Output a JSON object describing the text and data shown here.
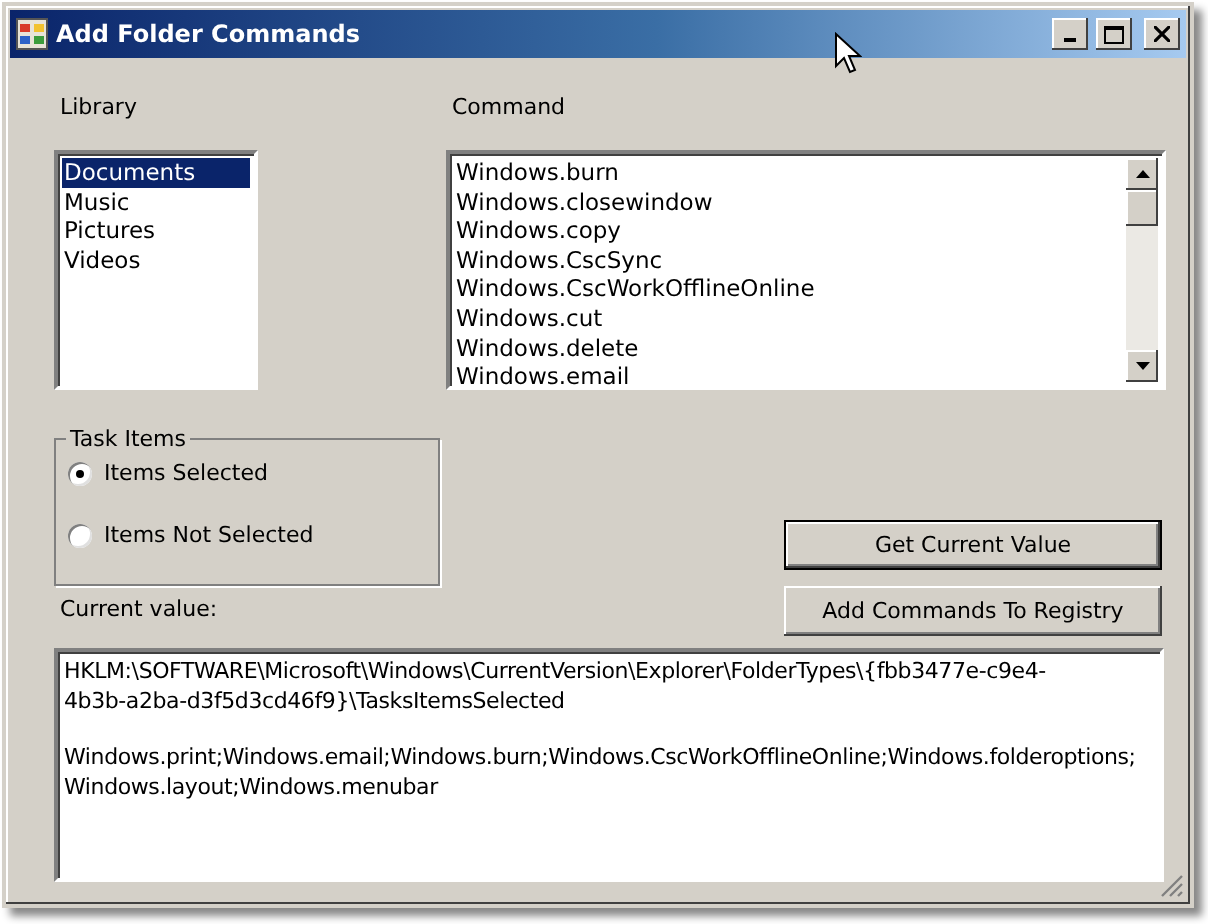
{
  "window": {
    "title": "Add Folder Commands"
  },
  "library": {
    "label": "Library",
    "items": [
      {
        "text": "Documents",
        "selected": true
      },
      {
        "text": "Music",
        "selected": false
      },
      {
        "text": "Pictures",
        "selected": false
      },
      {
        "text": "Videos",
        "selected": false
      }
    ]
  },
  "command": {
    "label": "Command",
    "items": [
      "Windows.burn",
      "Windows.closewindow",
      "Windows.copy",
      "Windows.CscSync",
      "Windows.CscWorkOfflineOnline",
      "Windows.cut",
      "Windows.delete",
      "Windows.email"
    ]
  },
  "task_items": {
    "title": "Task Items",
    "options": [
      {
        "label": "Items Selected",
        "selected": true
      },
      {
        "label": "Items Not Selected",
        "selected": false
      }
    ]
  },
  "buttons": [
    {
      "label": "Get Current Value",
      "default": true
    },
    {
      "label": "Add Commands To Registry",
      "default": false
    }
  ],
  "current_value": {
    "label": "Current value:",
    "paragraphs": [
      [
        "HKLM:\\SOFTWARE\\Microsoft\\Windows\\CurrentVersion\\Explorer\\FolderTypes\\{fbb3477e-c9e4-",
        "4b3b-a2ba-d3f5d3cd46f9}\\TasksItemsSelected"
      ],
      [
        "Windows.print;Windows.email;Windows.burn;Windows.CscWorkOfflineOnline;Windows.folderoptions;",
        "Windows.layout;Windows.menubar"
      ]
    ]
  }
}
